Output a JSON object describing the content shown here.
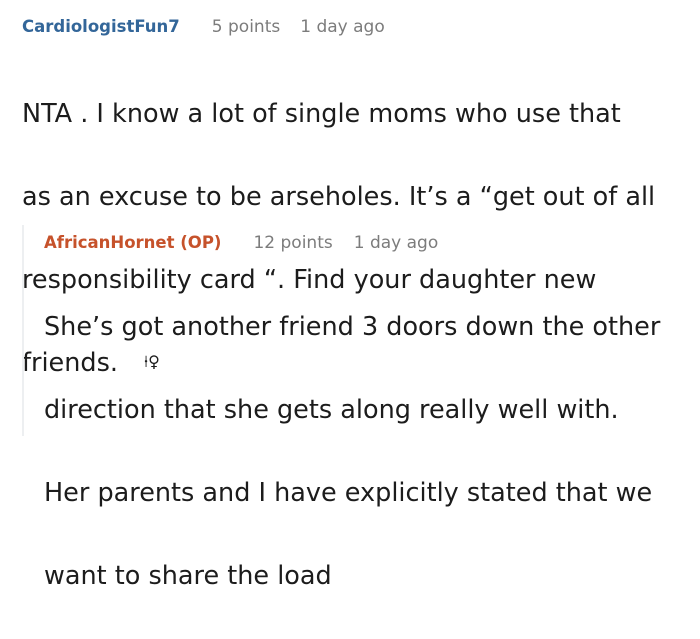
{
  "thread": {
    "comment": {
      "username": "CardiologistFun7",
      "points": "5 points",
      "time": "1 day ago",
      "lines": [
        "NTA . I know a lot of single moms who use that",
        "as an excuse to be arseholes. It’s a “get out of all",
        "responsibility card “. Find your daughter new",
        "friends."
      ],
      "trailing_glyph": "🧍‍♀️",
      "trailing_glyph_text": "⍿♀"
    },
    "reply": {
      "username": "AfricanHornet (OP)",
      "points": "12 points",
      "time": "1 day ago",
      "lines": [
        "She’s got another friend 3 doors down the other",
        "direction that she gets along really well with.",
        "Her parents and I have explicitly stated that we",
        "want to share the load"
      ]
    }
  },
  "colors": {
    "top_username": "#336699",
    "reply_username": "#c6522b",
    "meta_gray": "#7c7c7c",
    "text": "#1c1c1c",
    "thread_line": "#edeff1"
  }
}
